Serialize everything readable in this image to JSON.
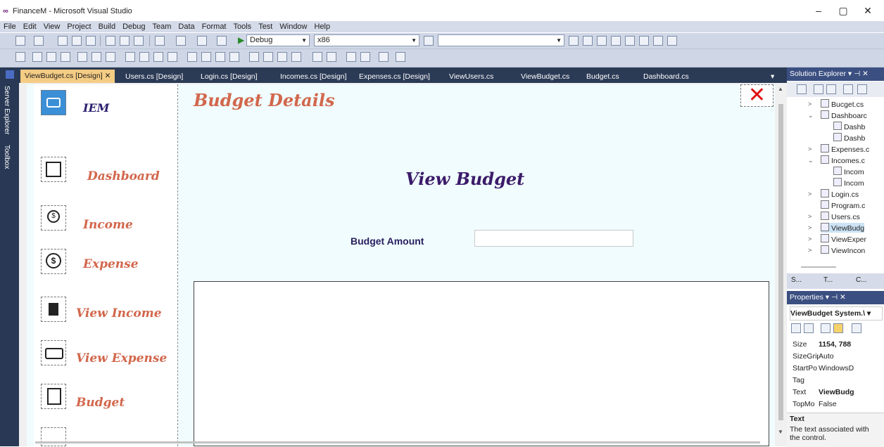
{
  "window": {
    "title": "FinanceM - Microsoft Visual Studio",
    "minimize": "–",
    "restore": "▢",
    "close": "✕"
  },
  "menu": [
    "File",
    "Edit",
    "View",
    "Project",
    "Build",
    "Debug",
    "Team",
    "Data",
    "Format",
    "Tools",
    "Test",
    "Window",
    "Help"
  ],
  "toolbar": {
    "config": "Debug",
    "platform": "x86"
  },
  "left_strip": {
    "server_explorer": "Server Explorer",
    "toolbox": "Toolbox"
  },
  "doc_tabs": [
    "ViewBudget.cs [Design]",
    "Users.cs [Design]",
    "Login.cs [Design]",
    "Incomes.cs [Design]",
    "Expenses.cs [Design]",
    "ViewUsers.cs",
    "ViewBudget.cs",
    "Budget.cs",
    "Dashboard.cs"
  ],
  "active_tab_close": "✕",
  "sidebar": {
    "brand": "IEM",
    "items": [
      "Dashboard",
      "Income",
      "Expense",
      "View Income",
      "View Expense",
      "Budget"
    ]
  },
  "form": {
    "title": "Budget Details",
    "heading": "View Budget",
    "amount_label": "Budget Amount",
    "amount_value": "",
    "close_glyph": "✕"
  },
  "solution_explorer": {
    "title": "Solution Explorer ▾ ⊣ ✕",
    "items": [
      "Bucget.cs",
      "Dashboarc",
      "Dashb",
      "Dashb",
      "Expenses.c",
      "Incomes.c",
      "Incom",
      "Incom",
      "Login.cs",
      "Program.c",
      "Users.cs",
      "ViewBudg",
      "ViewExper",
      "ViewIncon"
    ],
    "bottom_tabs": [
      "S...",
      "T...",
      "C..."
    ]
  },
  "properties": {
    "title": "Properties ▾ ⊣ ✕",
    "object": "ViewBudget  System.\\ ▾",
    "rows": [
      {
        "k": "Size",
        "v": "1154, 788"
      },
      {
        "k": "SizeGrip",
        "v": "Auto"
      },
      {
        "k": "StartPo",
        "v": "WindowsD"
      },
      {
        "k": "Tag",
        "v": ""
      },
      {
        "k": "Text",
        "v": "ViewBudg"
      },
      {
        "k": "TopMo",
        "v": "False"
      }
    ],
    "desc_title": "Text",
    "desc_body": "The text associated with the control."
  }
}
